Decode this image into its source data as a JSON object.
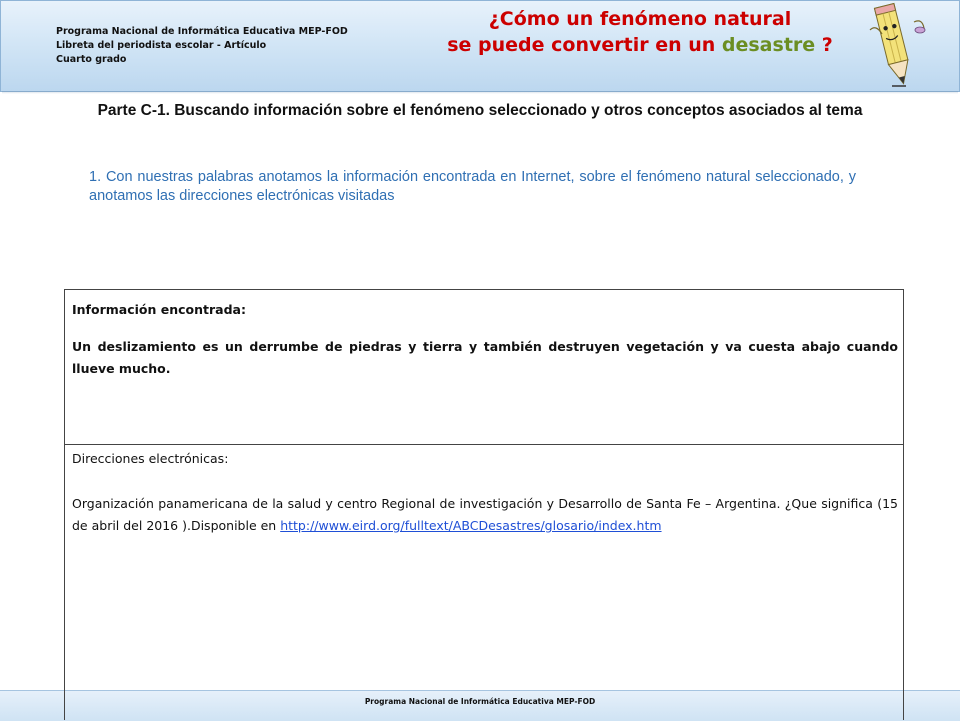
{
  "header": {
    "program_line1": "Programa Nacional de Informática Educativa MEP-FOD",
    "program_line2": "Libreta del periodista escolar -  Artículo",
    "program_line3": "Cuarto grado",
    "title_line1": "¿Cómo un fenómeno natural",
    "title_line2_part1": "se puede convertir en un ",
    "title_line2_word": "desastre",
    "title_line2_end": " ?",
    "title_color": "#cc0000",
    "highlight_color": "#6b8e23",
    "mascot_icon": "pencil-mascot-icon"
  },
  "section": {
    "heading": "Parte C-1. Buscando información sobre el fenómeno  seleccionado y otros conceptos asociados al tema",
    "instruction": "1. Con nuestras palabras anotamos la información encontrada en Internet, sobre el fenómeno natural seleccionado, y anotamos las direcciones  electrónicas visitadas"
  },
  "table": {
    "info_label": "Información encontrada:",
    "info_text": "Un  deslizamiento  es  un  derrumbe  de  piedras  y  tierra  y  también  destruyen  vegetación  y  va cuesta  abajo  cuando  llueve  mucho.",
    "urls_label": "Direcciones electrónicas:",
    "urls_text": "Organización  panamericana  de  la  salud  y  centro  Regional  de  investigación  y  Desarrollo  de  Santa Fe – Argentina.  ¿Que  significa  (15 de  abril  del   2016 ).Disponible  en  ",
    "urls_link": "http://www.eird.org/fulltext/ABCDesastres/glosario/index.htm"
  },
  "footer": {
    "text": "Programa  Nacional de Informática  Educativa MEP-FOD"
  }
}
